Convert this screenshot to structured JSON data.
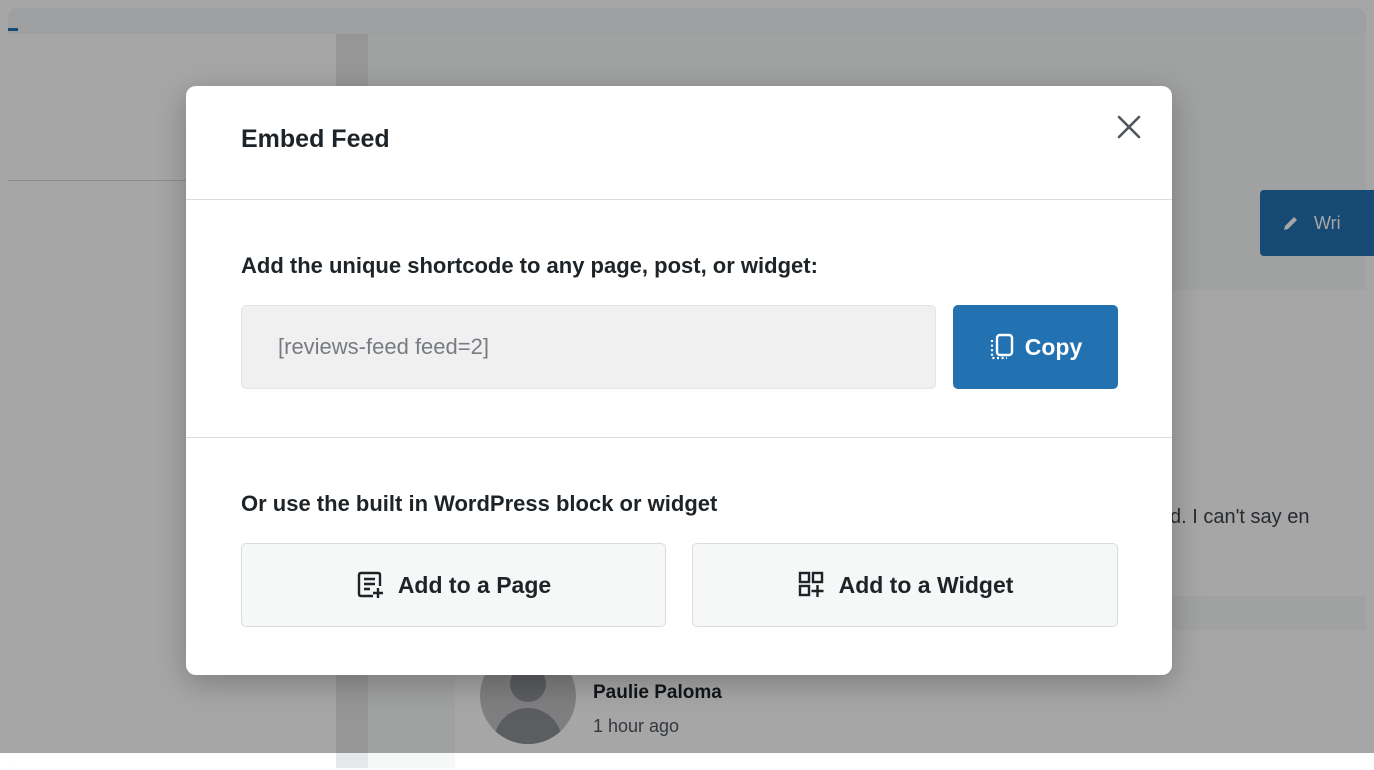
{
  "background": {
    "write_button_label": "Wri",
    "review_snippet": "d. I can't say en",
    "reviewer": {
      "name": "Paulie Paloma",
      "time": "1 hour ago"
    }
  },
  "modal": {
    "title": "Embed Feed",
    "close_icon": "close-icon",
    "shortcode_section": {
      "label": "Add the unique shortcode to any page, post, or widget:",
      "shortcode_value": "[reviews-feed feed=2]",
      "copy_label": "Copy",
      "copy_icon": "copy-icon"
    },
    "block_section": {
      "label": "Or use the built in WordPress block or widget",
      "add_page_label": "Add to a Page",
      "add_page_icon": "page-add-icon",
      "add_widget_label": "Add to a Widget",
      "add_widget_icon": "widget-add-icon"
    }
  },
  "colors": {
    "accent": "#2271b1",
    "overlay": "rgba(0,0,0,0.35)",
    "text": "#1d2327"
  }
}
